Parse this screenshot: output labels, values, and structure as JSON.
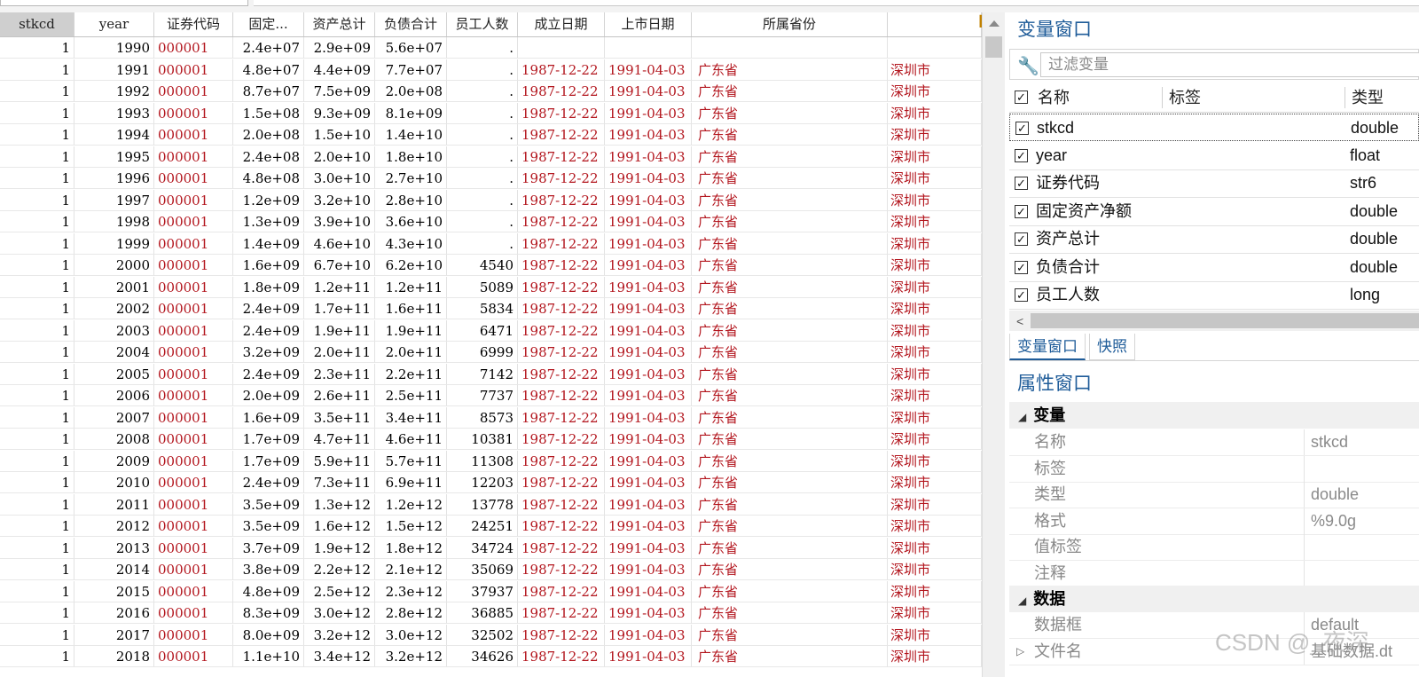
{
  "grid": {
    "columns": [
      "stkcd",
      "year",
      "证券代码",
      "固定...",
      "资产总计",
      "负债合计",
      "员工人数",
      "成立日期",
      "上市日期",
      "所属省份",
      ""
    ],
    "rows": [
      [
        "1",
        "1990",
        "000001",
        "2.4e+07",
        "2.9e+09",
        "5.6e+07",
        ".",
        "",
        "",
        "",
        ""
      ],
      [
        "1",
        "1991",
        "000001",
        "4.8e+07",
        "4.4e+09",
        "7.7e+07",
        ".",
        "1987-12-22",
        "1991-04-03",
        "广东省",
        "深圳市"
      ],
      [
        "1",
        "1992",
        "000001",
        "8.7e+07",
        "7.5e+09",
        "2.0e+08",
        ".",
        "1987-12-22",
        "1991-04-03",
        "广东省",
        "深圳市"
      ],
      [
        "1",
        "1993",
        "000001",
        "1.5e+08",
        "9.3e+09",
        "8.1e+09",
        ".",
        "1987-12-22",
        "1991-04-03",
        "广东省",
        "深圳市"
      ],
      [
        "1",
        "1994",
        "000001",
        "2.0e+08",
        "1.5e+10",
        "1.4e+10",
        ".",
        "1987-12-22",
        "1991-04-03",
        "广东省",
        "深圳市"
      ],
      [
        "1",
        "1995",
        "000001",
        "2.4e+08",
        "2.0e+10",
        "1.8e+10",
        ".",
        "1987-12-22",
        "1991-04-03",
        "广东省",
        "深圳市"
      ],
      [
        "1",
        "1996",
        "000001",
        "4.8e+08",
        "3.0e+10",
        "2.7e+10",
        ".",
        "1987-12-22",
        "1991-04-03",
        "广东省",
        "深圳市"
      ],
      [
        "1",
        "1997",
        "000001",
        "1.2e+09",
        "3.2e+10",
        "2.8e+10",
        ".",
        "1987-12-22",
        "1991-04-03",
        "广东省",
        "深圳市"
      ],
      [
        "1",
        "1998",
        "000001",
        "1.3e+09",
        "3.9e+10",
        "3.6e+10",
        ".",
        "1987-12-22",
        "1991-04-03",
        "广东省",
        "深圳市"
      ],
      [
        "1",
        "1999",
        "000001",
        "1.4e+09",
        "4.6e+10",
        "4.3e+10",
        ".",
        "1987-12-22",
        "1991-04-03",
        "广东省",
        "深圳市"
      ],
      [
        "1",
        "2000",
        "000001",
        "1.6e+09",
        "6.7e+10",
        "6.2e+10",
        "4540",
        "1987-12-22",
        "1991-04-03",
        "广东省",
        "深圳市"
      ],
      [
        "1",
        "2001",
        "000001",
        "1.8e+09",
        "1.2e+11",
        "1.2e+11",
        "5089",
        "1987-12-22",
        "1991-04-03",
        "广东省",
        "深圳市"
      ],
      [
        "1",
        "2002",
        "000001",
        "2.4e+09",
        "1.7e+11",
        "1.6e+11",
        "5834",
        "1987-12-22",
        "1991-04-03",
        "广东省",
        "深圳市"
      ],
      [
        "1",
        "2003",
        "000001",
        "2.4e+09",
        "1.9e+11",
        "1.9e+11",
        "6471",
        "1987-12-22",
        "1991-04-03",
        "广东省",
        "深圳市"
      ],
      [
        "1",
        "2004",
        "000001",
        "3.2e+09",
        "2.0e+11",
        "2.0e+11",
        "6999",
        "1987-12-22",
        "1991-04-03",
        "广东省",
        "深圳市"
      ],
      [
        "1",
        "2005",
        "000001",
        "2.4e+09",
        "2.3e+11",
        "2.2e+11",
        "7142",
        "1987-12-22",
        "1991-04-03",
        "广东省",
        "深圳市"
      ],
      [
        "1",
        "2006",
        "000001",
        "2.0e+09",
        "2.6e+11",
        "2.5e+11",
        "7737",
        "1987-12-22",
        "1991-04-03",
        "广东省",
        "深圳市"
      ],
      [
        "1",
        "2007",
        "000001",
        "1.6e+09",
        "3.5e+11",
        "3.4e+11",
        "8573",
        "1987-12-22",
        "1991-04-03",
        "广东省",
        "深圳市"
      ],
      [
        "1",
        "2008",
        "000001",
        "1.7e+09",
        "4.7e+11",
        "4.6e+11",
        "10381",
        "1987-12-22",
        "1991-04-03",
        "广东省",
        "深圳市"
      ],
      [
        "1",
        "2009",
        "000001",
        "1.7e+09",
        "5.9e+11",
        "5.7e+11",
        "11308",
        "1987-12-22",
        "1991-04-03",
        "广东省",
        "深圳市"
      ],
      [
        "1",
        "2010",
        "000001",
        "2.4e+09",
        "7.3e+11",
        "6.9e+11",
        "12203",
        "1987-12-22",
        "1991-04-03",
        "广东省",
        "深圳市"
      ],
      [
        "1",
        "2011",
        "000001",
        "3.5e+09",
        "1.3e+12",
        "1.2e+12",
        "13778",
        "1987-12-22",
        "1991-04-03",
        "广东省",
        "深圳市"
      ],
      [
        "1",
        "2012",
        "000001",
        "3.5e+09",
        "1.6e+12",
        "1.5e+12",
        "24251",
        "1987-12-22",
        "1991-04-03",
        "广东省",
        "深圳市"
      ],
      [
        "1",
        "2013",
        "000001",
        "3.7e+09",
        "1.9e+12",
        "1.8e+12",
        "34724",
        "1987-12-22",
        "1991-04-03",
        "广东省",
        "深圳市"
      ],
      [
        "1",
        "2014",
        "000001",
        "3.8e+09",
        "2.2e+12",
        "2.1e+12",
        "35069",
        "1987-12-22",
        "1991-04-03",
        "广东省",
        "深圳市"
      ],
      [
        "1",
        "2015",
        "000001",
        "4.8e+09",
        "2.5e+12",
        "2.3e+12",
        "37937",
        "1987-12-22",
        "1991-04-03",
        "广东省",
        "深圳市"
      ],
      [
        "1",
        "2016",
        "000001",
        "8.3e+09",
        "3.0e+12",
        "2.8e+12",
        "36885",
        "1987-12-22",
        "1991-04-03",
        "广东省",
        "深圳市"
      ],
      [
        "1",
        "2017",
        "000001",
        "8.0e+09",
        "3.2e+12",
        "3.0e+12",
        "32502",
        "1987-12-22",
        "1991-04-03",
        "广东省",
        "深圳市"
      ],
      [
        "1",
        "2018",
        "000001",
        "1.1e+10",
        "3.4e+12",
        "3.2e+12",
        "34626",
        "1987-12-22",
        "1991-04-03",
        "广东省",
        "深圳市"
      ]
    ]
  },
  "var_window": {
    "title": "变量窗口",
    "filter_placeholder": "过滤变量",
    "headers": {
      "name": "名称",
      "label": "标签",
      "type": "类型"
    },
    "vars": [
      {
        "name": "stkcd",
        "type": "double"
      },
      {
        "name": "year",
        "type": "float"
      },
      {
        "name": "证券代码",
        "type": "str6"
      },
      {
        "name": "固定资产净额",
        "type": "double"
      },
      {
        "name": "资产总计",
        "type": "double"
      },
      {
        "name": "负债合计",
        "type": "double"
      },
      {
        "name": "员工人数",
        "type": "long"
      }
    ],
    "scroll_left": "<",
    "tabs": [
      "变量窗口",
      "快照"
    ]
  },
  "prop_window": {
    "title": "属性窗口",
    "var_group": "变量",
    "var_props": [
      {
        "k": "名称",
        "v": "stkcd"
      },
      {
        "k": "标签",
        "v": ""
      },
      {
        "k": "类型",
        "v": "double"
      },
      {
        "k": "格式",
        "v": "%9.0g"
      },
      {
        "k": "值标签",
        "v": ""
      },
      {
        "k": "注释",
        "v": ""
      }
    ],
    "data_group": "数据",
    "data_props": [
      {
        "k": "数据框",
        "v": "default"
      },
      {
        "k": "文件名",
        "v": "基础数据.dt"
      }
    ]
  },
  "watermark": "CSDN @_夜深",
  "colors": {
    "accent": "#1f5c99",
    "string_cell": "#b3161e",
    "selected_header": "#cfcfcf"
  }
}
